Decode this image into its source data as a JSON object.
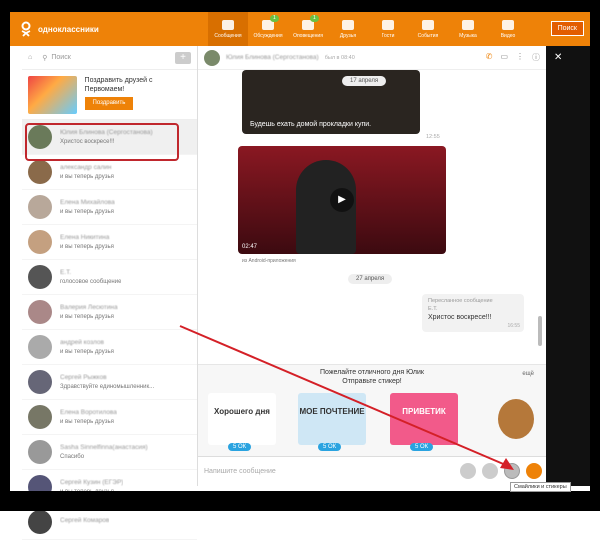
{
  "brand": {
    "name": "одноклассники",
    "accent": "#ee8208"
  },
  "nav": [
    {
      "label": "Сообщения",
      "icon": "envelope-icon",
      "active": true,
      "badge": ""
    },
    {
      "label": "Обсуждения",
      "icon": "chat-bubble-icon",
      "badge": "1"
    },
    {
      "label": "Оповещения",
      "icon": "bell-icon",
      "badge": "1"
    },
    {
      "label": "Друзья",
      "icon": "people-icon",
      "badge": ""
    },
    {
      "label": "Гости",
      "icon": "footprints-icon",
      "badge": ""
    },
    {
      "label": "События",
      "icon": "events-icon",
      "badge": ""
    },
    {
      "label": "Музыка",
      "icon": "music-icon",
      "badge": ""
    },
    {
      "label": "Видео",
      "icon": "video-icon",
      "badge": ""
    }
  ],
  "search_button": "Поиск",
  "sidebar": {
    "search_placeholder": "Поиск",
    "promo": {
      "text": "Поздравить друзей с Первомаем!",
      "button": "Поздравить"
    },
    "chats": [
      {
        "name": "Юлия Блинова (Сергостанова)",
        "msg": "Христос воскресе!!!"
      },
      {
        "name": "александр салин",
        "msg": "и вы теперь друзья"
      },
      {
        "name": "Елена Михайлова",
        "msg": "и вы теперь друзья"
      },
      {
        "name": "Елена Никитина",
        "msg": "и вы теперь друзья"
      },
      {
        "name": "Е.Т.",
        "msg": "голосовое сообщение"
      },
      {
        "name": "Валерия Лесютина",
        "msg": "и вы теперь друзья"
      },
      {
        "name": "андрей козлов",
        "msg": "и вы теперь друзья"
      },
      {
        "name": "Сергей Рыжков",
        "msg": "Здравствуйте единомышленник..."
      },
      {
        "name": "Елена Воротилова",
        "msg": "и вы теперь друзья"
      },
      {
        "name": "Sasha Sinnelfinna(анастасия)",
        "msg": "Спасибо"
      },
      {
        "name": "Сергей Кузин (ЕГЭР)",
        "msg": "и вы теперь друзья"
      },
      {
        "name": "Сергей Комаров",
        "msg": ""
      }
    ]
  },
  "conversation": {
    "name": "Юлия Блинова (Сергостанова)",
    "status": "был в 08:40",
    "date1": "17 апреля",
    "video1_caption": "Будешь ехать домой прокладки купи.",
    "video1_time": "12:55",
    "video2_duration": "02:47",
    "video2_source": "из Android-приложения",
    "date2": "27 апреля",
    "forwarded_label": "Пересланное сообщение",
    "forwarded_from": "Е.Т.",
    "forwarded_text": "Христос воскресе!!!",
    "forwarded_time": "16:55"
  },
  "stickers": {
    "title_line1": "Пожелайте отличного дня Юлик",
    "title_line2": "Отправьте стикер!",
    "more": "ещё",
    "items": [
      {
        "text": "Хорошего дня",
        "price": "5 ОК"
      },
      {
        "text": "МОЕ ПОЧТЕНИЕ",
        "price": "5 ОК"
      },
      {
        "text": "ПРИВЕТИК",
        "price": "5 ОК"
      },
      {
        "text": "",
        "price": ""
      }
    ]
  },
  "input": {
    "placeholder": "Напишите сообщение"
  },
  "tooltip": "Смайлики и стикеры"
}
